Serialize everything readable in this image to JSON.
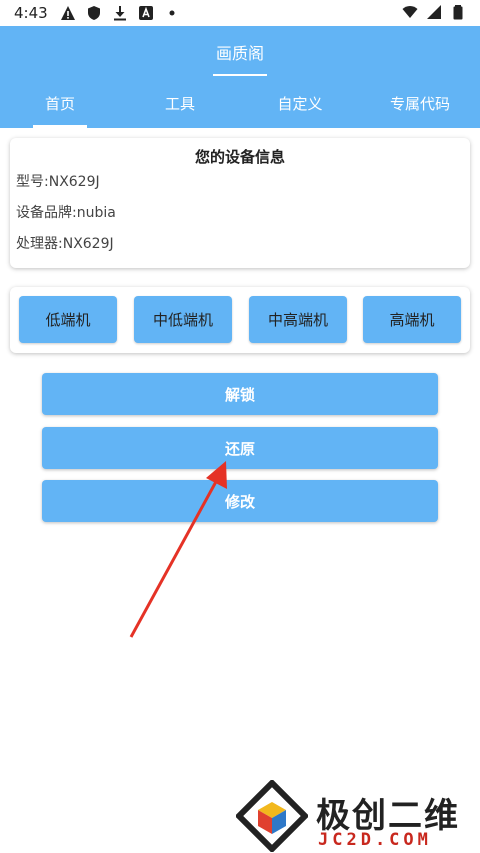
{
  "status_bar": {
    "time": "4:43",
    "left_icons": [
      "warning-icon",
      "shield-icon",
      "download-icon",
      "a-icon",
      "dot-icon"
    ],
    "right_icons": [
      "wifi-icon",
      "signal-icon",
      "battery-icon"
    ]
  },
  "header": {
    "title": "画质阁"
  },
  "tabs": [
    {
      "label": "首页",
      "active": true
    },
    {
      "label": "工具",
      "active": false
    },
    {
      "label": "自定义",
      "active": false
    },
    {
      "label": "专属代码",
      "active": false
    }
  ],
  "device_info": {
    "title": "您的设备信息",
    "model": "型号:NX629J",
    "brand": "设备品牌:nubia",
    "processor": "处理器:NX629J"
  },
  "tiers": [
    "低端机",
    "中低端机",
    "中高端机",
    "高端机"
  ],
  "actions": {
    "unlock": "解锁",
    "restore": "还原",
    "modify": "修改"
  },
  "watermark": {
    "title": "极创二维",
    "subtitle": "JC2D.COM"
  },
  "colors": {
    "accent": "#62b4f5",
    "arrow": "#e53226"
  }
}
